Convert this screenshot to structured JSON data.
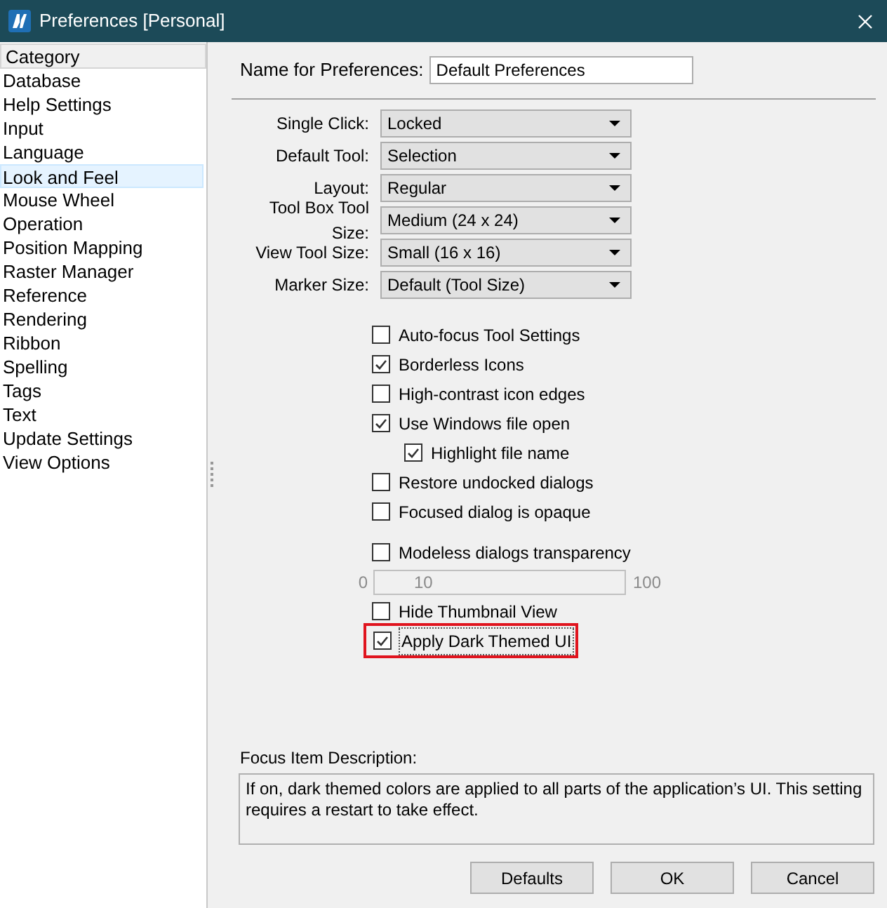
{
  "window": {
    "title": "Preferences [Personal]"
  },
  "sidebar": {
    "header": "Category",
    "items": [
      {
        "label": "Database",
        "selected": false
      },
      {
        "label": "Help Settings",
        "selected": false
      },
      {
        "label": "Input",
        "selected": false
      },
      {
        "label": "Language",
        "selected": false
      },
      {
        "label": "Look and Feel",
        "selected": true
      },
      {
        "label": "Mouse Wheel",
        "selected": false
      },
      {
        "label": "Operation",
        "selected": false
      },
      {
        "label": "Position Mapping",
        "selected": false
      },
      {
        "label": "Raster Manager",
        "selected": false
      },
      {
        "label": "Reference",
        "selected": false
      },
      {
        "label": "Rendering",
        "selected": false
      },
      {
        "label": "Ribbon",
        "selected": false
      },
      {
        "label": "Spelling",
        "selected": false
      },
      {
        "label": "Tags",
        "selected": false
      },
      {
        "label": "Text",
        "selected": false
      },
      {
        "label": "Update Settings",
        "selected": false
      },
      {
        "label": "View Options",
        "selected": false
      }
    ]
  },
  "name_field": {
    "label": "Name for Preferences:",
    "value": "Default Preferences"
  },
  "dropdowns": [
    {
      "label": "Single Click:",
      "value": "Locked"
    },
    {
      "label": "Default Tool:",
      "value": "Selection"
    },
    {
      "label": "Layout:",
      "value": "Regular"
    },
    {
      "label": "Tool Box Tool Size:",
      "value": "Medium (24 x 24)"
    },
    {
      "label": "View Tool Size:",
      "value": "Small (16 x 16)"
    },
    {
      "label": "Marker Size:",
      "value": "Default (Tool Size)"
    }
  ],
  "options": [
    {
      "kind": "checkbox",
      "label": "Auto-focus Tool Settings",
      "checked": false
    },
    {
      "kind": "checkbox",
      "label": "Borderless Icons",
      "checked": true
    },
    {
      "kind": "checkbox",
      "label": "High-contrast icon edges",
      "checked": false
    },
    {
      "kind": "checkbox",
      "label": "Use Windows file open",
      "checked": true
    },
    {
      "kind": "subcheckbox",
      "label": "Highlight file name",
      "checked": true
    },
    {
      "kind": "checkbox",
      "label": "Restore undocked dialogs",
      "checked": false
    },
    {
      "kind": "checkbox",
      "label": "Focused dialog is opaque",
      "checked": false
    },
    {
      "kind": "spacer"
    },
    {
      "kind": "checkbox",
      "label": "Modeless dialogs transparency",
      "checked": false
    },
    {
      "kind": "range",
      "min": "0",
      "value": "10",
      "max": "100"
    },
    {
      "kind": "checkbox",
      "label": "Hide Thumbnail View",
      "checked": false
    },
    {
      "kind": "checkbox",
      "label": "Apply Dark Themed UI",
      "checked": true,
      "highlighted": true
    }
  ],
  "description": {
    "label": "Focus Item Description:",
    "text": "If on, dark themed colors are applied to all parts of the application’s UI. This setting requires a restart to take effect."
  },
  "buttons": [
    "Defaults",
    "OK",
    "Cancel"
  ]
}
